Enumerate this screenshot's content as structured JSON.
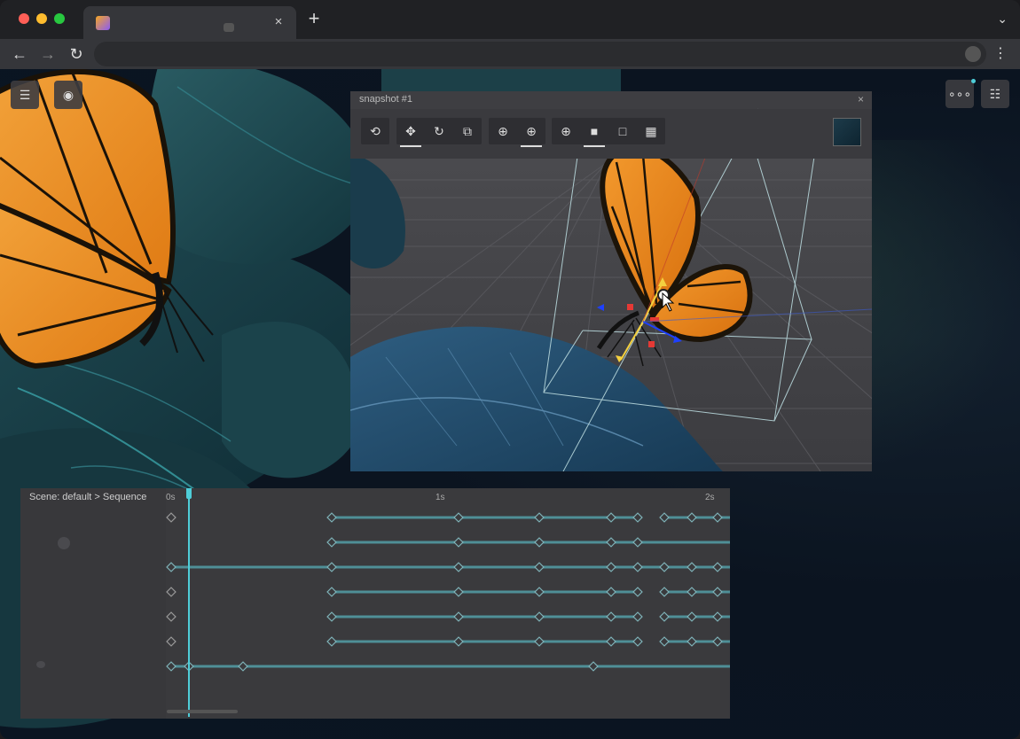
{
  "browser": {
    "tab_close": "×",
    "new_tab": "+",
    "tab_menu": "⌄",
    "back": "←",
    "forward": "→",
    "reload": "↻",
    "menu": "⋮"
  },
  "viewport_controls": {
    "left_buttons": [
      "list-icon",
      "camera-icon"
    ],
    "right_buttons": [
      "more-icon",
      "settings-icon"
    ]
  },
  "snapshot": {
    "title": "snapshot #1",
    "close": "×",
    "toolbar_groups": [
      [
        "sync-icon"
      ],
      [
        "move-icon",
        "rotate-icon",
        "scale-icon"
      ],
      [
        "globe-icon",
        "local-icon"
      ],
      [
        "globe-small-icon",
        "cube-solid-icon",
        "cube-outline-icon",
        "cube-wire-icon"
      ]
    ]
  },
  "timeline": {
    "breadcrumb": "Scene: default > Sequence",
    "ruler": [
      "0s",
      "1s",
      "2s"
    ]
  },
  "colors": {
    "accent": "#4ecdd8",
    "track": "#4f8f97",
    "gizmo_x": "#e53935",
    "gizmo_y": "#f4d03f",
    "gizmo_z": "#1e40ff"
  }
}
